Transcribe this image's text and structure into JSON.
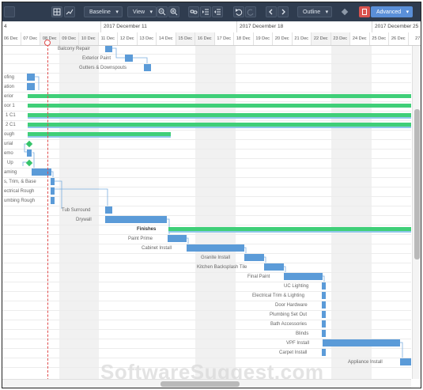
{
  "toolbar": {
    "baseline_label": "Baseline",
    "view_label": "View",
    "outline_label": "Outline",
    "advanced_label": "Advanced"
  },
  "timeline": {
    "top_fragment": "4",
    "week1": "2017 December 11",
    "week2": "2017 December 18",
    "week3": "2017 December 25",
    "days": [
      "06 Dec",
      "07 Dec",
      "08 Dec",
      "09 Dec",
      "10 Dec",
      "11 Dec",
      "12 Dec",
      "13 Dec",
      "14 Dec",
      "15 Dec",
      "16 Dec",
      "17 Dec",
      "18 Dec",
      "19 Dec",
      "20 Dec",
      "21 Dec",
      "22 Dec",
      "23 Dec",
      "24 Dec",
      "25 Dec",
      "26 Dec",
      "27"
    ]
  },
  "tasks": {
    "balcony_repair": "Balcony Repair",
    "exterior_paint": "Exterior Paint",
    "gutters": "Gutters & Downspouts",
    "roofing": "ofing",
    "foundation": "ation",
    "interior": "erior",
    "floor1": "oor 1",
    "c1a": "1 C1",
    "c1b": "2 C1",
    "rough": "ough",
    "final": "urial",
    "demo": "emo",
    "up": "Up",
    "framing": "aming",
    "trim": "s, Trim, & Base",
    "electrical_rough": "ectrical Rough",
    "plumbing_rough": "umbing Rough",
    "tub_surround": "Tub Surround",
    "drywall": "Drywall",
    "finishes": "Finishes",
    "paint_prime": "Paint Prime",
    "cabinet_install": "Cabinet Install",
    "granite_install": "Granite Install",
    "kitchen_backsplash": "Kitchen Backsplash Tile",
    "final_paint": "Final Paint",
    "uc_lighting": "UC Lighting",
    "electrical_trim": "Electrical Trim & Lighting",
    "door_hardware": "Door Hardware",
    "plumbing_setout": "Plumbing Set Out",
    "bath_accessories": "Bath Accessories",
    "blinds": "Blinds",
    "vpf_install": "VPF Install",
    "carpet_install": "Carpet Install",
    "appliance_install": "Appliance Install"
  },
  "watermark": "SoftwareSuggest.com",
  "colors": {
    "bar": "#5b9bd8",
    "summary": "#3fcf78",
    "today": "#e04c4c",
    "toolbar": "#2f3c4f"
  }
}
